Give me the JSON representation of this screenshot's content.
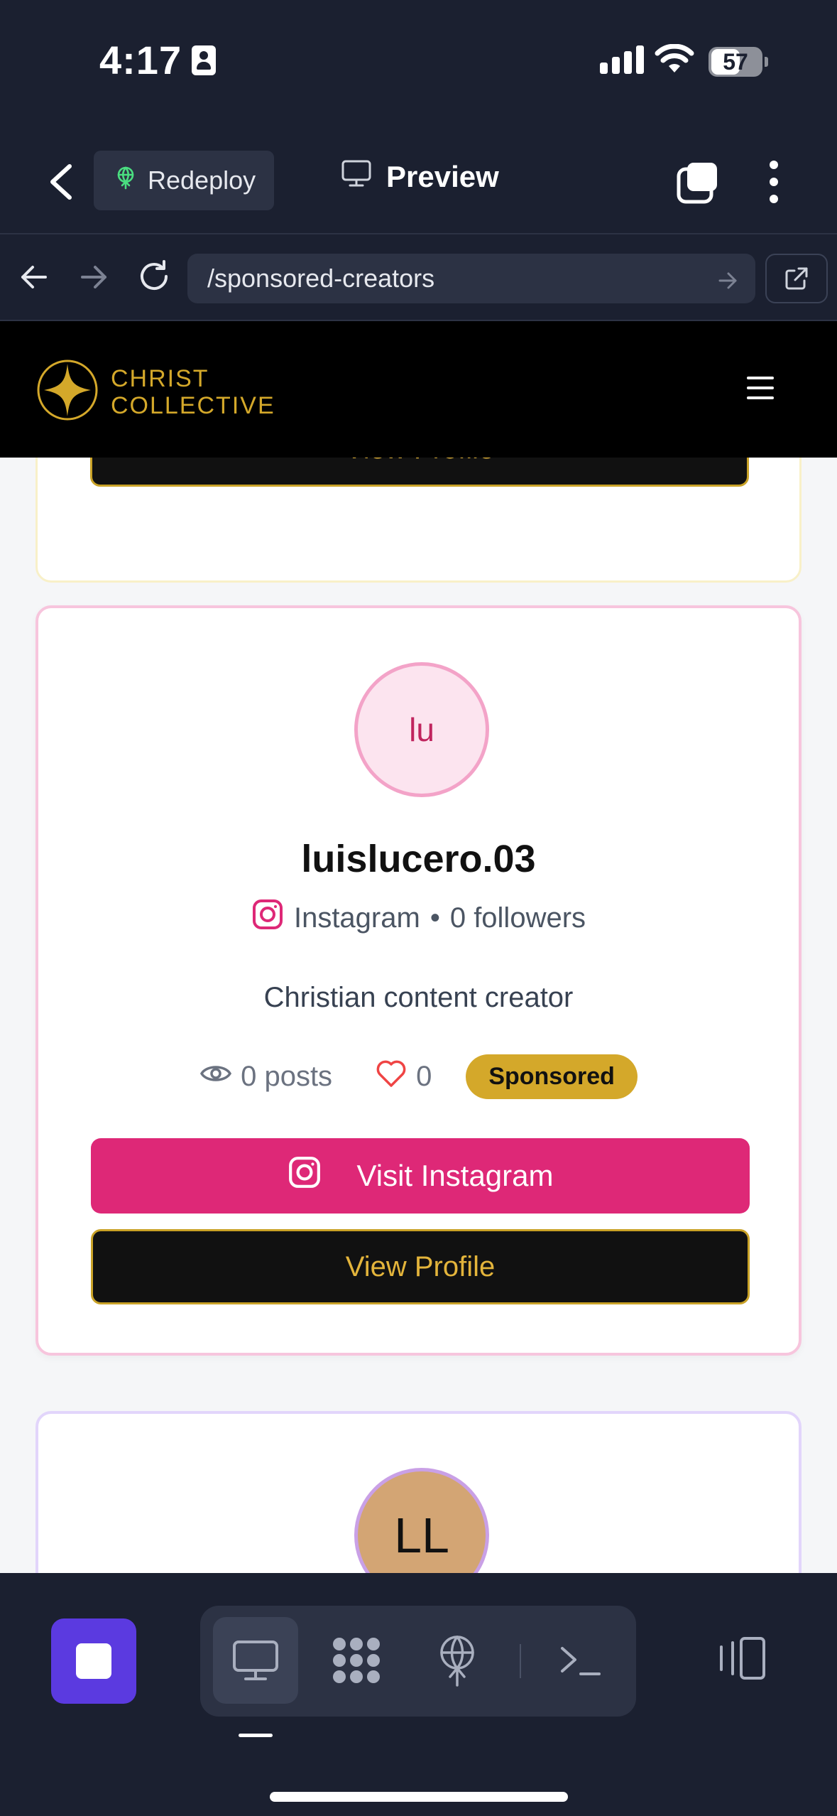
{
  "status_bar": {
    "time": "4:17",
    "battery": "57"
  },
  "app_bar": {
    "redeploy_label": "Redeploy",
    "preview_label": "Preview"
  },
  "browser": {
    "url": "/sponsored-creators"
  },
  "site": {
    "logo_line1": "CHRIST",
    "logo_line2": "COLLECTIVE"
  },
  "cards": {
    "previous": {
      "view_profile_label": "View Profile"
    },
    "main": {
      "avatar_initials": "lu",
      "username": "luislucero.03",
      "platform": "Instagram",
      "separator": "•",
      "followers": "0 followers",
      "bio": "Christian content creator",
      "posts": "0 posts",
      "likes": "0",
      "badge": "Sponsored",
      "visit_label": "Visit Instagram",
      "view_profile_label": "View Profile"
    },
    "next": {
      "avatar_initials": "LL"
    }
  },
  "colors": {
    "accent_gold": "#d4a82a",
    "instagram_pink": "#de2877",
    "dark_bg": "#1b2030",
    "stop_purple": "#5b3ae0"
  },
  "icons": [
    "contact-card-icon",
    "cell-signal-icon",
    "wifi-icon",
    "battery-icon",
    "back-chevron-icon",
    "antenna-icon",
    "monitor-icon",
    "tabs-icon",
    "more-vertical-icon",
    "arrow-left-icon",
    "arrow-right-icon",
    "reload-icon",
    "external-link-icon",
    "star-logo-icon",
    "hamburger-icon",
    "instagram-icon",
    "eye-icon",
    "heart-icon",
    "stop-icon",
    "apps-grid-icon",
    "terminal-icon",
    "device-switch-icon"
  ]
}
